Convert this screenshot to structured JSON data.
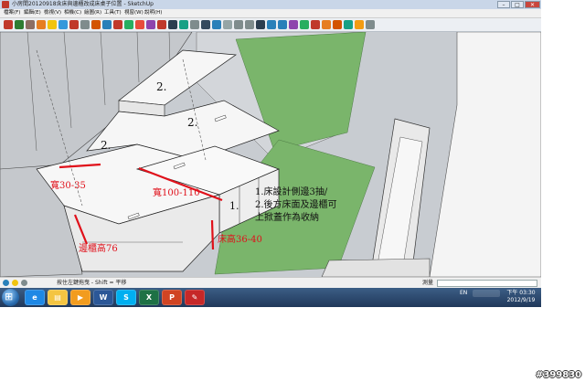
{
  "window": {
    "title": "小房間20120918含床與邊櫃改成床桌子位置 - SketchUp",
    "controls": [
      "–",
      "□",
      "✕"
    ]
  },
  "menu": [
    "檔案(F)",
    "編輯(E)",
    "檢視(V)",
    "相機(C)",
    "繪圖(R)",
    "工具(T)",
    "視窗(W)",
    "說明(H)"
  ],
  "toolbar": {
    "icons": [
      "select-arrow-icon",
      "pencil-icon",
      "rectangle-icon",
      "circle-icon",
      "arc-icon",
      "polygon-icon",
      "eraser-icon",
      "tape-measure-icon",
      "paint-bucket-icon",
      "push-pull-icon",
      "rotate-icon",
      "follow-me-icon",
      "scale-icon",
      "offset-icon",
      "move-icon",
      "text-icon",
      "axes-icon",
      "dimension-icon",
      "protractor-icon",
      "orbit-icon",
      "pan-icon",
      "zoom-icon",
      "zoom-window-icon",
      "zoom-extents-icon",
      "previous-view-icon",
      "next-view-icon",
      "walk-icon",
      "look-around-icon",
      "position-camera-icon",
      "section-plane-icon",
      "get-models-icon",
      "share-model-icon",
      "components-icon",
      "layers-icon"
    ],
    "colors": [
      "#c0392b",
      "#2e7d32",
      "#8d6e63",
      "#e67e22",
      "#f1c40f",
      "#3498db",
      "#c0392b",
      "#7f8c8d",
      "#d35400",
      "#2980b9",
      "#c0392b",
      "#27ae60",
      "#e74c3c",
      "#8e44ad",
      "#c0392b",
      "#2c3e50",
      "#16a085",
      "#7f8c8d",
      "#34495e",
      "#2980b9",
      "#95a5a6",
      "#7f8c8d",
      "#7f8c8d",
      "#2c3e50",
      "#2980b9",
      "#2980b9",
      "#8e44ad",
      "#27ae60",
      "#c0392b",
      "#e67e22",
      "#d35400",
      "#16a085",
      "#f39c12",
      "#7f8c8d"
    ]
  },
  "scene": {
    "labels": {
      "step_top": "2.",
      "step_mid": "2.",
      "step_left": "2.",
      "width_left": "寬30-35",
      "width_bed": "寬100-110",
      "bed_number": "1.",
      "side_height": "邊櫃高76",
      "bed_height": "床高36-40"
    },
    "note_lines": [
      "1.床設計側邊3抽/",
      "2.後方床面及邊櫃可",
      "上掀蓋作為收納"
    ],
    "colors": {
      "annotation_red": "#e0101a",
      "floor_green": "#7ab56b",
      "wall_gray": "#c4c7cc",
      "panel_white": "#f6f6f6",
      "edge": "#222222"
    }
  },
  "statusbar": {
    "hint": "按住左鍵拖曳 - Shift = 平移",
    "measure_label": "測量"
  },
  "taskbar": {
    "apps": [
      "e",
      "▤",
      "▶",
      "W",
      "S",
      "X",
      "P",
      "✎"
    ],
    "app_names": [
      "internet-explorer-icon",
      "file-explorer-icon",
      "media-player-icon",
      "word-icon",
      "skype-icon",
      "excel-icon",
      "powerpoint-icon",
      "sketchup-icon"
    ],
    "app_colors": [
      "#1e88e5",
      "#f4c542",
      "#f29c1f",
      "#2b5797",
      "#00aff0",
      "#1e7145",
      "#d04423",
      "#c62828"
    ],
    "lang": "EN",
    "time": "下午 03:30",
    "date": "2012/9/19"
  },
  "watermark": "#399830"
}
